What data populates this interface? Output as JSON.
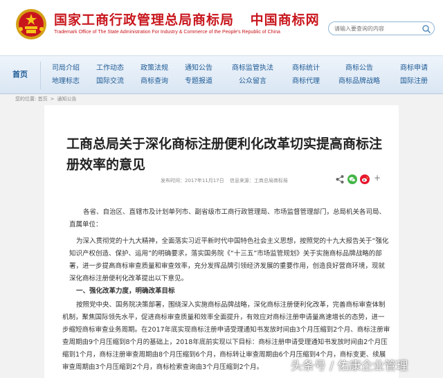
{
  "header": {
    "title_main": "国家工商行政管理总局商标局",
    "title_sub": "中国商标网",
    "title_en": "Trademark Office of The State Administration For Industry & Commerce of the People's Republic of China",
    "search_placeholder": "请输入要查询的内容"
  },
  "nav": {
    "home": "首页",
    "items": [
      {
        "top": "司局介绍",
        "bottom": "地理标志"
      },
      {
        "top": "工作动态",
        "bottom": "国际交流"
      },
      {
        "top": "政策法规",
        "bottom": "商标查询"
      },
      {
        "top": "通知公告",
        "bottom": "专题报道"
      },
      {
        "top": "商标监管执法",
        "bottom": "公众留言"
      },
      {
        "top": "商标统计",
        "bottom": "商标代理"
      },
      {
        "top": "商标公告",
        "bottom": "商标品牌战略"
      },
      {
        "top": "商标申请",
        "bottom": "国际注册"
      }
    ]
  },
  "breadcrumb": {
    "label": "您的位置:",
    "home": "首页",
    "arrow": ">",
    "current": "通知公告"
  },
  "article": {
    "title": "工商总局关于深化商标注册便利化改革切实提高商标注册效率的意见",
    "meta_date": "发布时间：2017年11月17日",
    "meta_source": "信息来源：工商总局商标局",
    "share_plus": "+",
    "p1": "各省、自治区、直辖市及计划单列市、副省级市工商行政管理局、市场监督管理部门，总局机关各司局、直属单位：",
    "p2": "为深入贯彻党的十九大精神，全面落实习近平新时代中国特色社会主义思想，按照党的十九大报告关于“强化知识产权创造、保护、运用”的明确要求，落实国务院《“十三五”市场监管规划》关于实施商标品牌战略的部署，进一步提高商标审查质量和审查效率，充分发挥品牌引领经济发展的重要作用，创造良好营商环境，现就深化商标注册便利化改革提出以下意见。",
    "h1": "一、强化改革力度，明确改革目标",
    "p3": "按照党中央、国务院决策部署，围绕深入实施商标品牌战略，深化商标注册便利化改革，完善商标审查体制机制，聚焦国际领先水平，促进商标审查质量和效率全面提升，有效应对商标注册申请量高速增长的态势，进一步缩短商标审查业务周期。在2017年底实现商标注册申请受理通知书发放时间由3个月压缩到2个月、商标注册审查周期由9个月压缩到8个月的基础上，2018年底前实现以下目标：商标注册申请受理通知书发放时间由2个月压缩到1个月，商标注册审查周期由8个月压缩到6个月，商标转让审查周期由6个月压缩到4个月，商标变更、续展审查周期由3个月压缩到2个月，商标检索查询由3个月压缩到2个月。"
  },
  "watermark": "头条号 / 佑康企业管理",
  "colors": {
    "brand_red": "#c8161d",
    "nav_text": "#1f5b96"
  }
}
